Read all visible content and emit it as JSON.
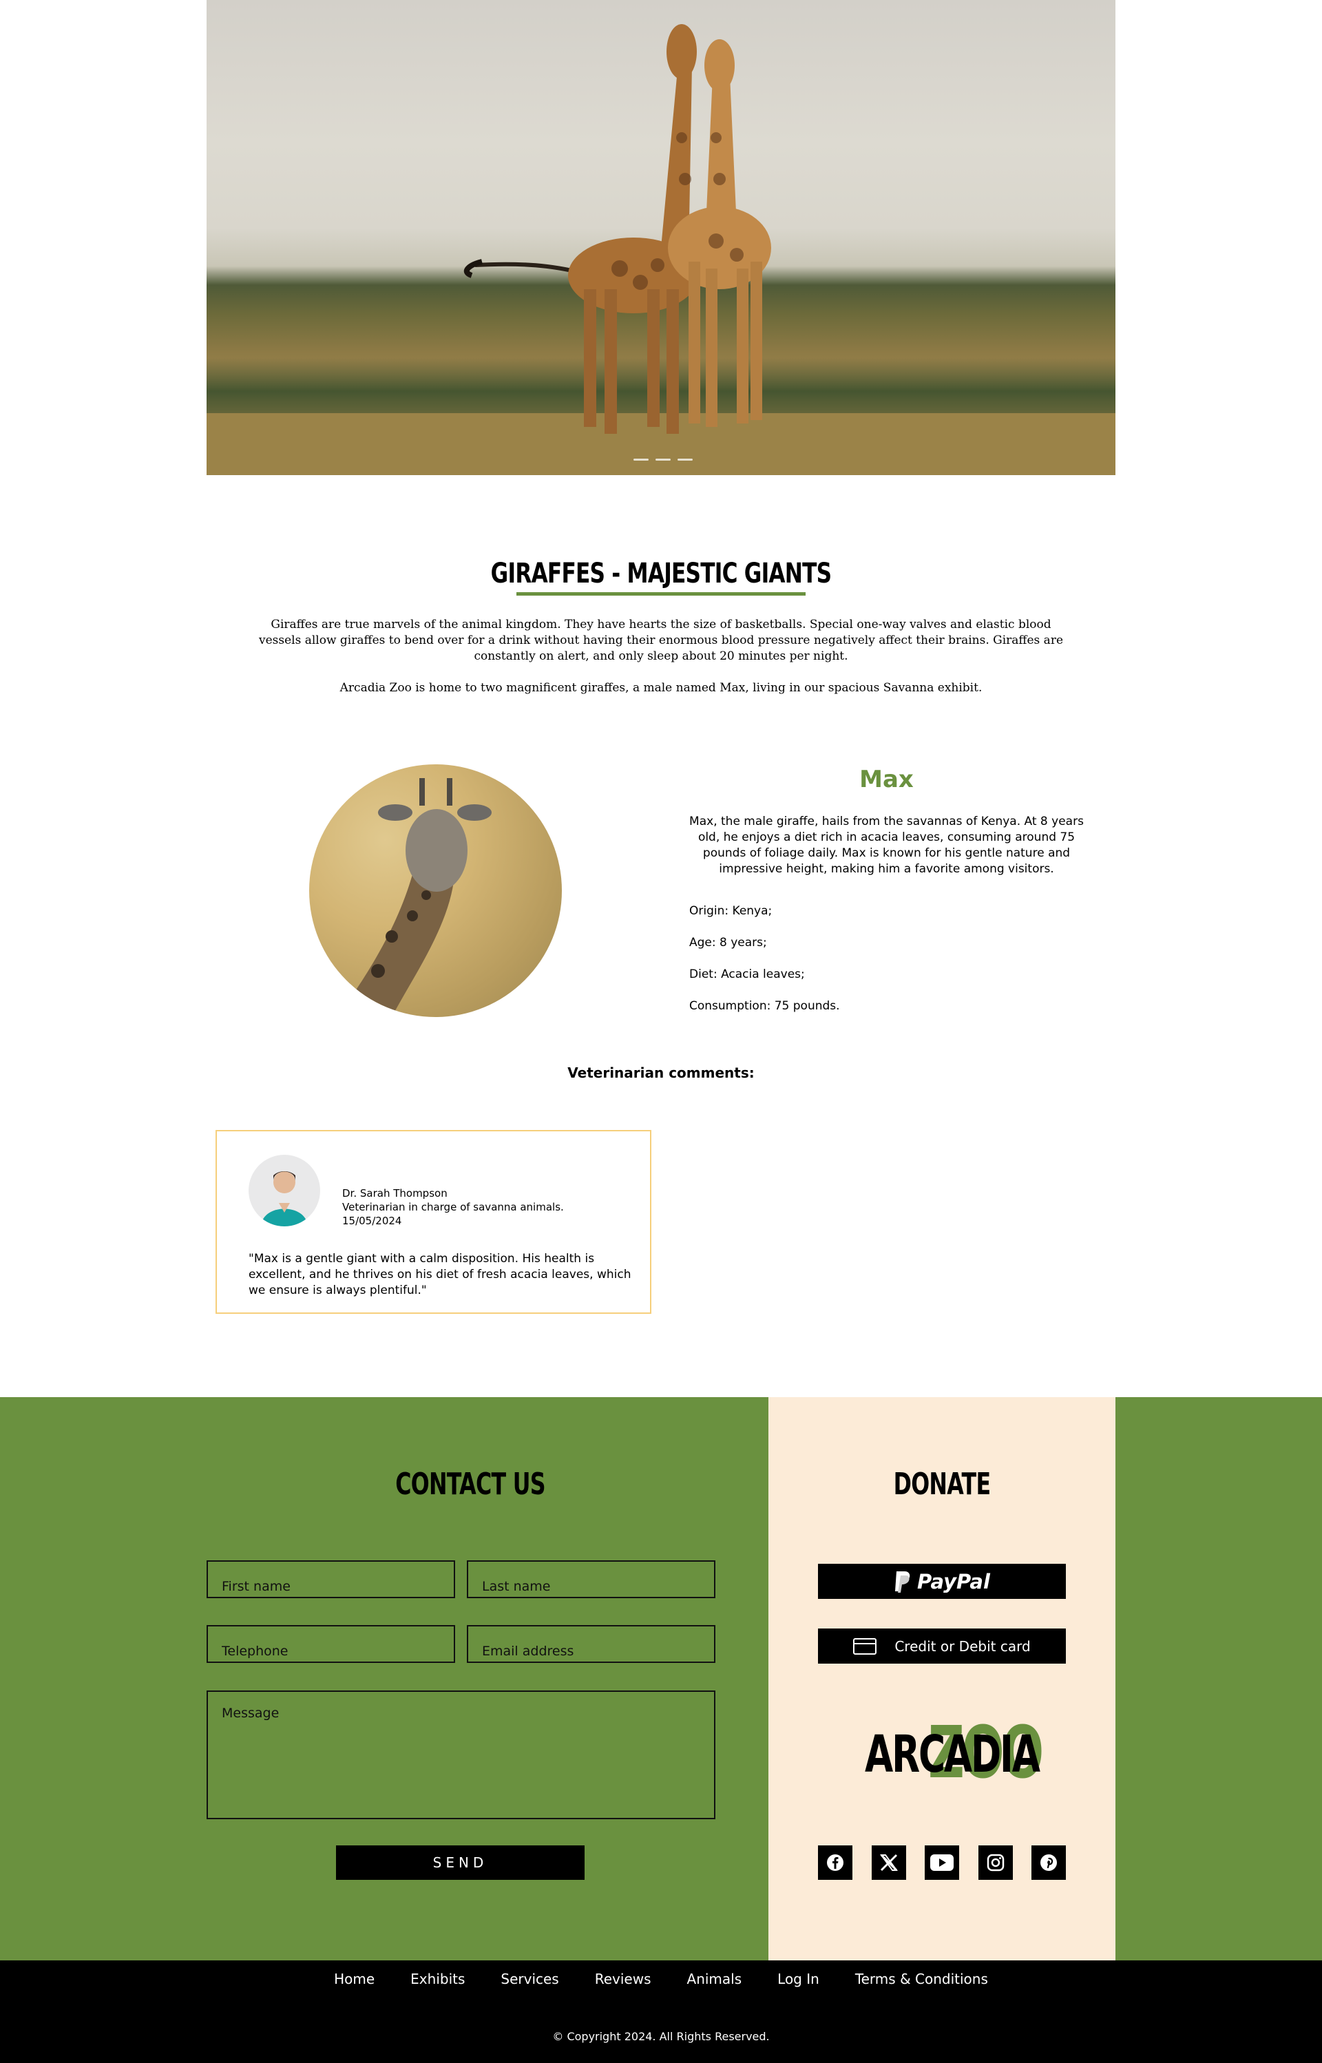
{
  "hero": {
    "menu_icon": "hamburger-menu-icon",
    "carousel_dots": 3
  },
  "intro": {
    "title": "GIRAFFES - MAJESTIC GIANTS",
    "paragraph1": "Giraffes are true marvels of the animal kingdom. They have hearts the size of basketballs. Special one-way valves and elastic blood vessels allow giraffes to bend over for a drink without having their enormous blood pressure negatively affect their brains. Giraffes are constantly on alert, and only sleep about 20 minutes per night.",
    "paragraph2": "Arcadia Zoo is home to two magnificent giraffes, a male named Max, living in our spacious Savanna exhibit."
  },
  "animal": {
    "name": "Max",
    "description": "Max, the male giraffe, hails from the savannas of Kenya. At 8 years old, he enjoys a diet rich in acacia leaves, consuming around 75 pounds of foliage daily. Max is known for his gentle nature and impressive height, making him a favorite among visitors.",
    "origin": "Origin: Kenya;",
    "age": "Age: 8 years;",
    "diet": "Diet: Acacia leaves;",
    "consumption": "Consumption: 75 pounds."
  },
  "vet": {
    "heading": "Veterinarian comments:",
    "name": "Dr. Sarah Thompson",
    "role": "Veterinarian in charge of savanna animals.",
    "date": "15/05/2024",
    "comment": "\"Max is a gentle giant with a calm disposition. His health is excellent, and he thrives on his diet of fresh acacia leaves, which we ensure is always plentiful.\""
  },
  "contact": {
    "title": "CONTACT US",
    "first_name_placeholder": "First name",
    "last_name_placeholder": "Last name",
    "telephone_placeholder": "Telephone",
    "email_placeholder": "Email address",
    "message_placeholder": "Message",
    "send_label": "SEND"
  },
  "donate": {
    "title": "DONATE",
    "paypal_label": "PayPal",
    "card_label": "Credit or Debit card"
  },
  "logo": {
    "word1": "ARCADIA",
    "word2": "ZOO"
  },
  "social": [
    "facebook-icon",
    "x-icon",
    "youtube-icon",
    "instagram-icon",
    "pinterest-icon"
  ],
  "nav": {
    "items": [
      "Home",
      "Exhibits",
      "Services",
      "Reviews",
      "Animals",
      "Log In",
      "Terms & Conditions"
    ]
  },
  "footer": {
    "copyright": "© Copyright 2024. All Rights Reserved."
  },
  "colors": {
    "brand_green": "#6a913f",
    "donate_bg": "#fcebd7",
    "card_border": "#f6cf7c"
  }
}
